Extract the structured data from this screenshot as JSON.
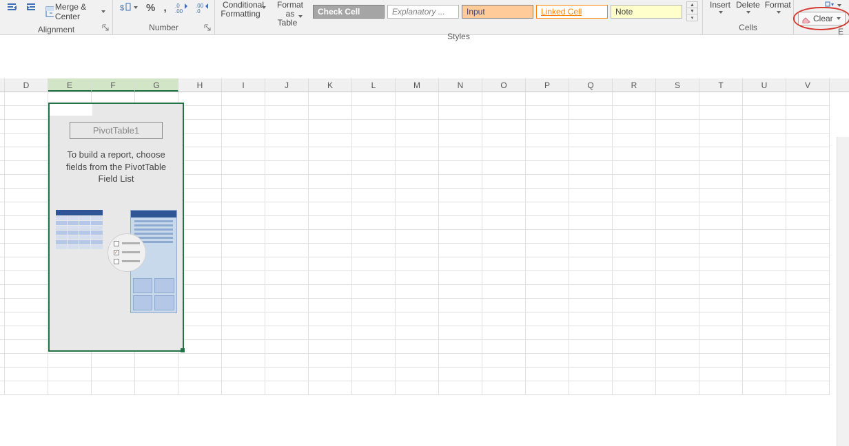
{
  "ribbon": {
    "alignment": {
      "title": "Alignment",
      "merge_label": "Merge & Center"
    },
    "number": {
      "title": "Number",
      "percent": "%",
      "comma": ","
    },
    "styles": {
      "title": "Styles",
      "conditional_line1": "Conditional",
      "conditional_line2": "Formatting",
      "format_table_line1": "Format as",
      "format_table_line2": "Table",
      "swatches": {
        "check": "Check Cell",
        "explanatory": "Explanatory ...",
        "input": "Input",
        "linked": "Linked Cell",
        "note": "Note"
      }
    },
    "cells": {
      "title": "Cells",
      "insert": "Insert",
      "delete": "Delete",
      "format": "Format"
    },
    "editing": {
      "title": "E",
      "clear": "Clear"
    }
  },
  "columns": [
    "",
    "D",
    "E",
    "F",
    "G",
    "H",
    "I",
    "J",
    "K",
    "L",
    "M",
    "N",
    "O",
    "P",
    "Q",
    "R",
    "S",
    "T",
    "U",
    "V"
  ],
  "selected_cols": [
    "E",
    "F",
    "G"
  ],
  "pivot": {
    "title": "PivotTable1",
    "message": "To build a report, choose fields from the PivotTable Field List"
  }
}
